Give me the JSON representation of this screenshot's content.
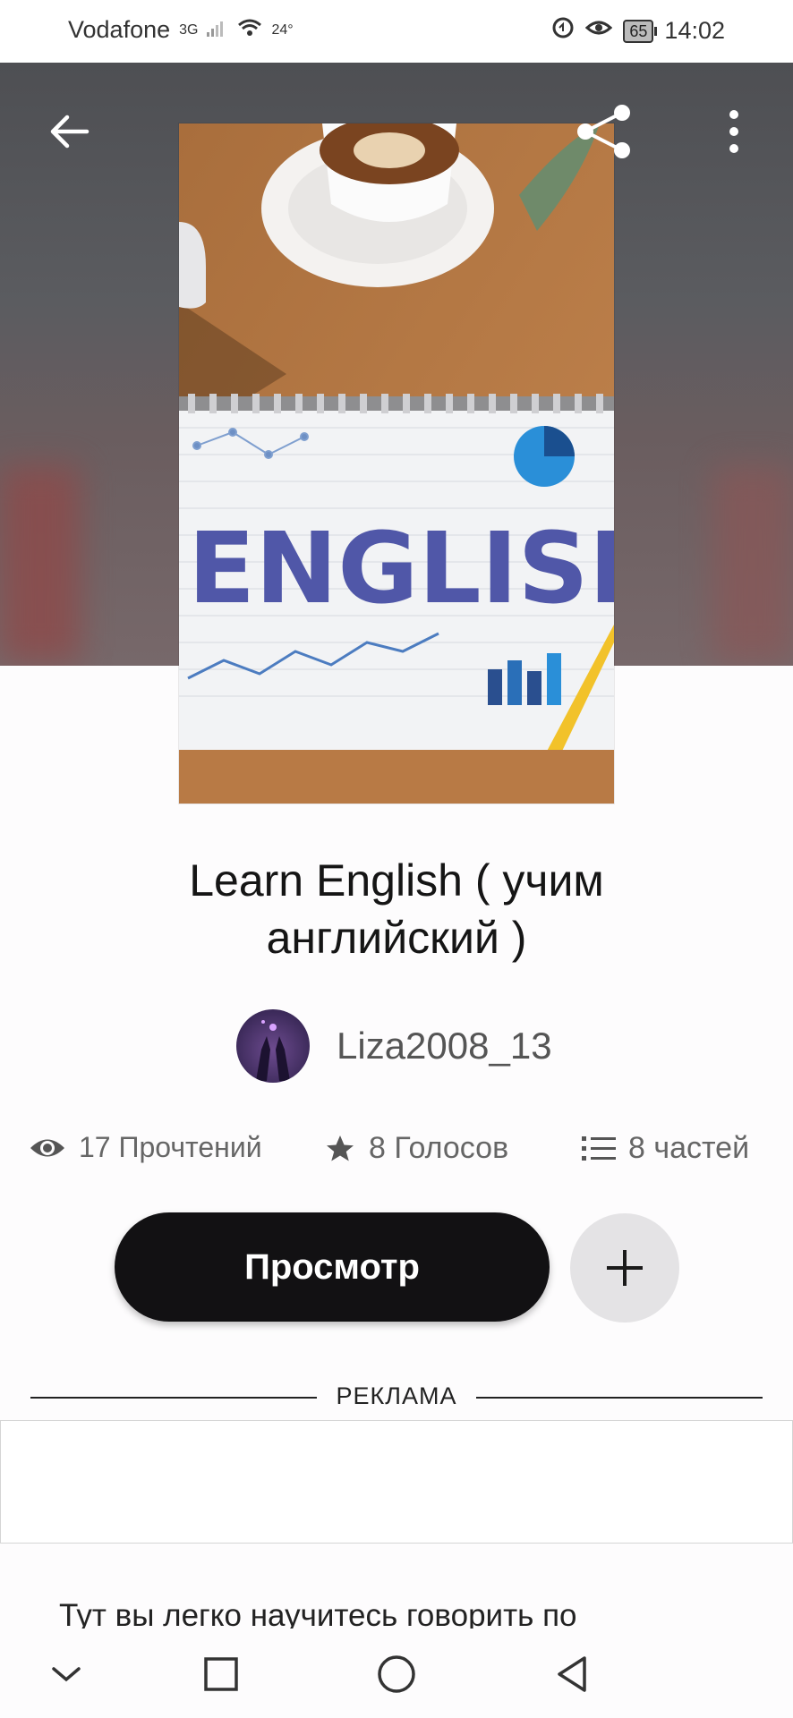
{
  "status_bar": {
    "carrier": "Vodafone",
    "network": "3G",
    "temperature": "24°",
    "battery": "65",
    "time": "14:02"
  },
  "header": {
    "back_icon": "arrow-left-icon",
    "share_icon": "share-icon",
    "more_icon": "more-vertical-icon"
  },
  "cover": {
    "cover_text": "ENGLISH"
  },
  "story": {
    "title": "Learn English ( учим английский )",
    "author": "Liza2008_13",
    "reads": "17 Прочтений",
    "votes": "8 Голосов",
    "parts": "8 частей",
    "read_button": "Просмотр",
    "description": "Тут вы легко научитесь говорить по"
  },
  "ad": {
    "label": "РЕКЛАМА"
  },
  "colors": {
    "primary_button": "#121113",
    "secondary_button": "#e4e3e5",
    "background": "#fdfcfd"
  }
}
